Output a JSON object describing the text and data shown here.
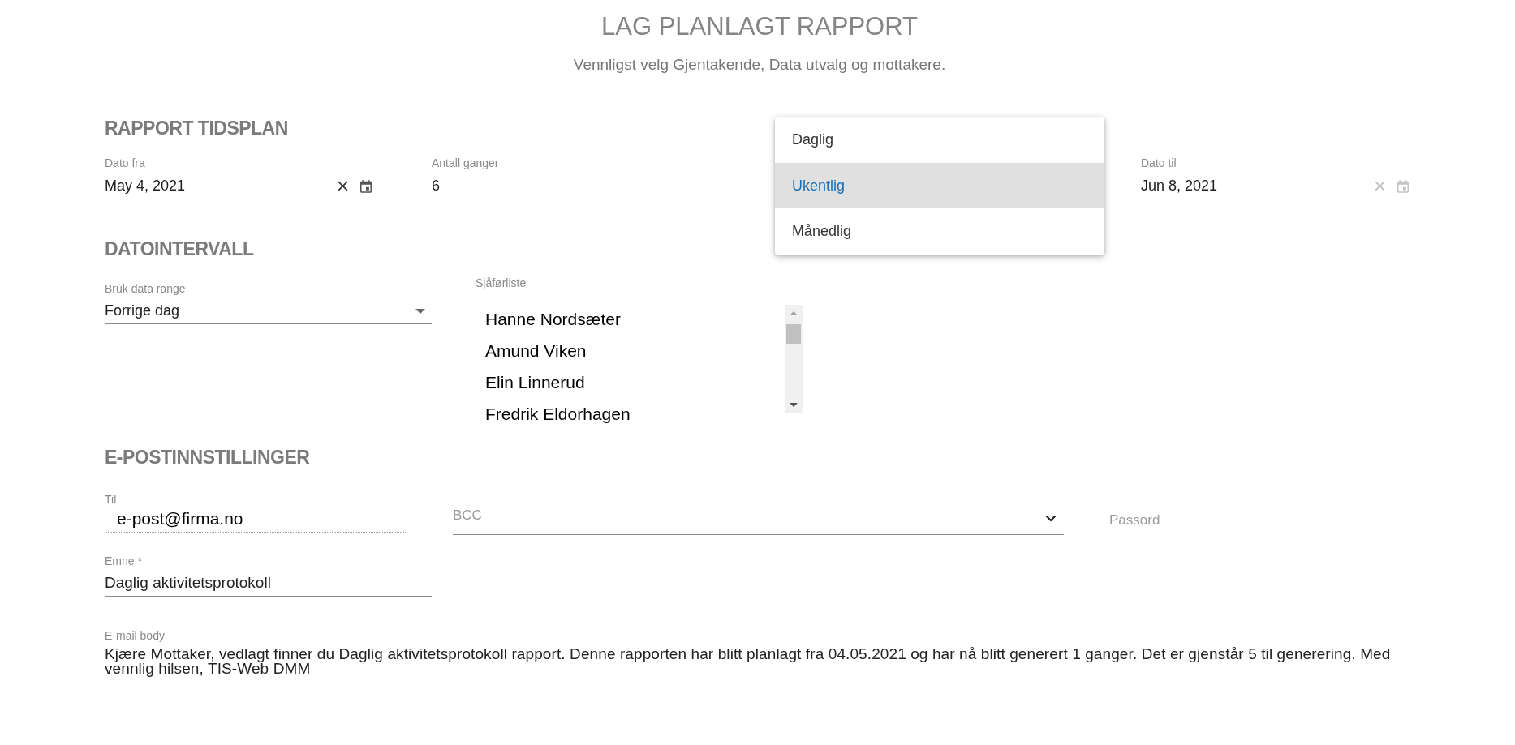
{
  "header": {
    "title": "LAG PLANLAGT RAPPORT",
    "subtitle": "Vennligst velg Gjentakende, Data utvalg og mottakere."
  },
  "schedule": {
    "heading": "RAPPORT TIDSPLAN",
    "date_from": {
      "label": "Dato fra",
      "value": "May 4, 2021",
      "hovered": true
    },
    "count": {
      "label": "Antall ganger",
      "value": "6"
    },
    "recurrence_menu": [
      {
        "label": "Daglig",
        "selected": false
      },
      {
        "label": "Ukentlig",
        "selected": true
      },
      {
        "label": "Månedlig",
        "selected": false
      }
    ],
    "date_to": {
      "label": "Dato til",
      "value": "Jun 8, 2021",
      "hovered": false
    }
  },
  "date_range": {
    "heading": "DATOINTERVALL",
    "range_select": {
      "label": "Bruk data range",
      "value": "Forrige dag"
    },
    "driver_list": {
      "label": "Sjåførliste",
      "items": [
        {
          "label": "Hanne Nordsæter",
          "selected": false
        },
        {
          "label": "Amund Viken",
          "selected": false
        },
        {
          "label": "Elin Linnerud",
          "selected": false
        },
        {
          "label": "Fredrik Eldorhagen",
          "selected": false
        }
      ]
    }
  },
  "email": {
    "heading": "E-POSTINNSTILLINGER",
    "to": {
      "label": "Til",
      "value": "e-post@firma.no"
    },
    "bcc": {
      "placeholder": "BCC"
    },
    "password": {
      "placeholder": "Passord"
    },
    "subject": {
      "label": "Emne *",
      "value": "Daglig aktivitetsprotokoll"
    },
    "body": {
      "label": "E-mail body",
      "value": "Kjære Mottaker, vedlagt finner du Daglig aktivitetsprotokoll rapport. Denne rapporten har blitt planlagt fra 04.05.2021 og har nå blitt generert 1 ganger. Det er gjenstår 5 til generering. Med vennlig hilsen, TIS-Web DMM"
    }
  }
}
